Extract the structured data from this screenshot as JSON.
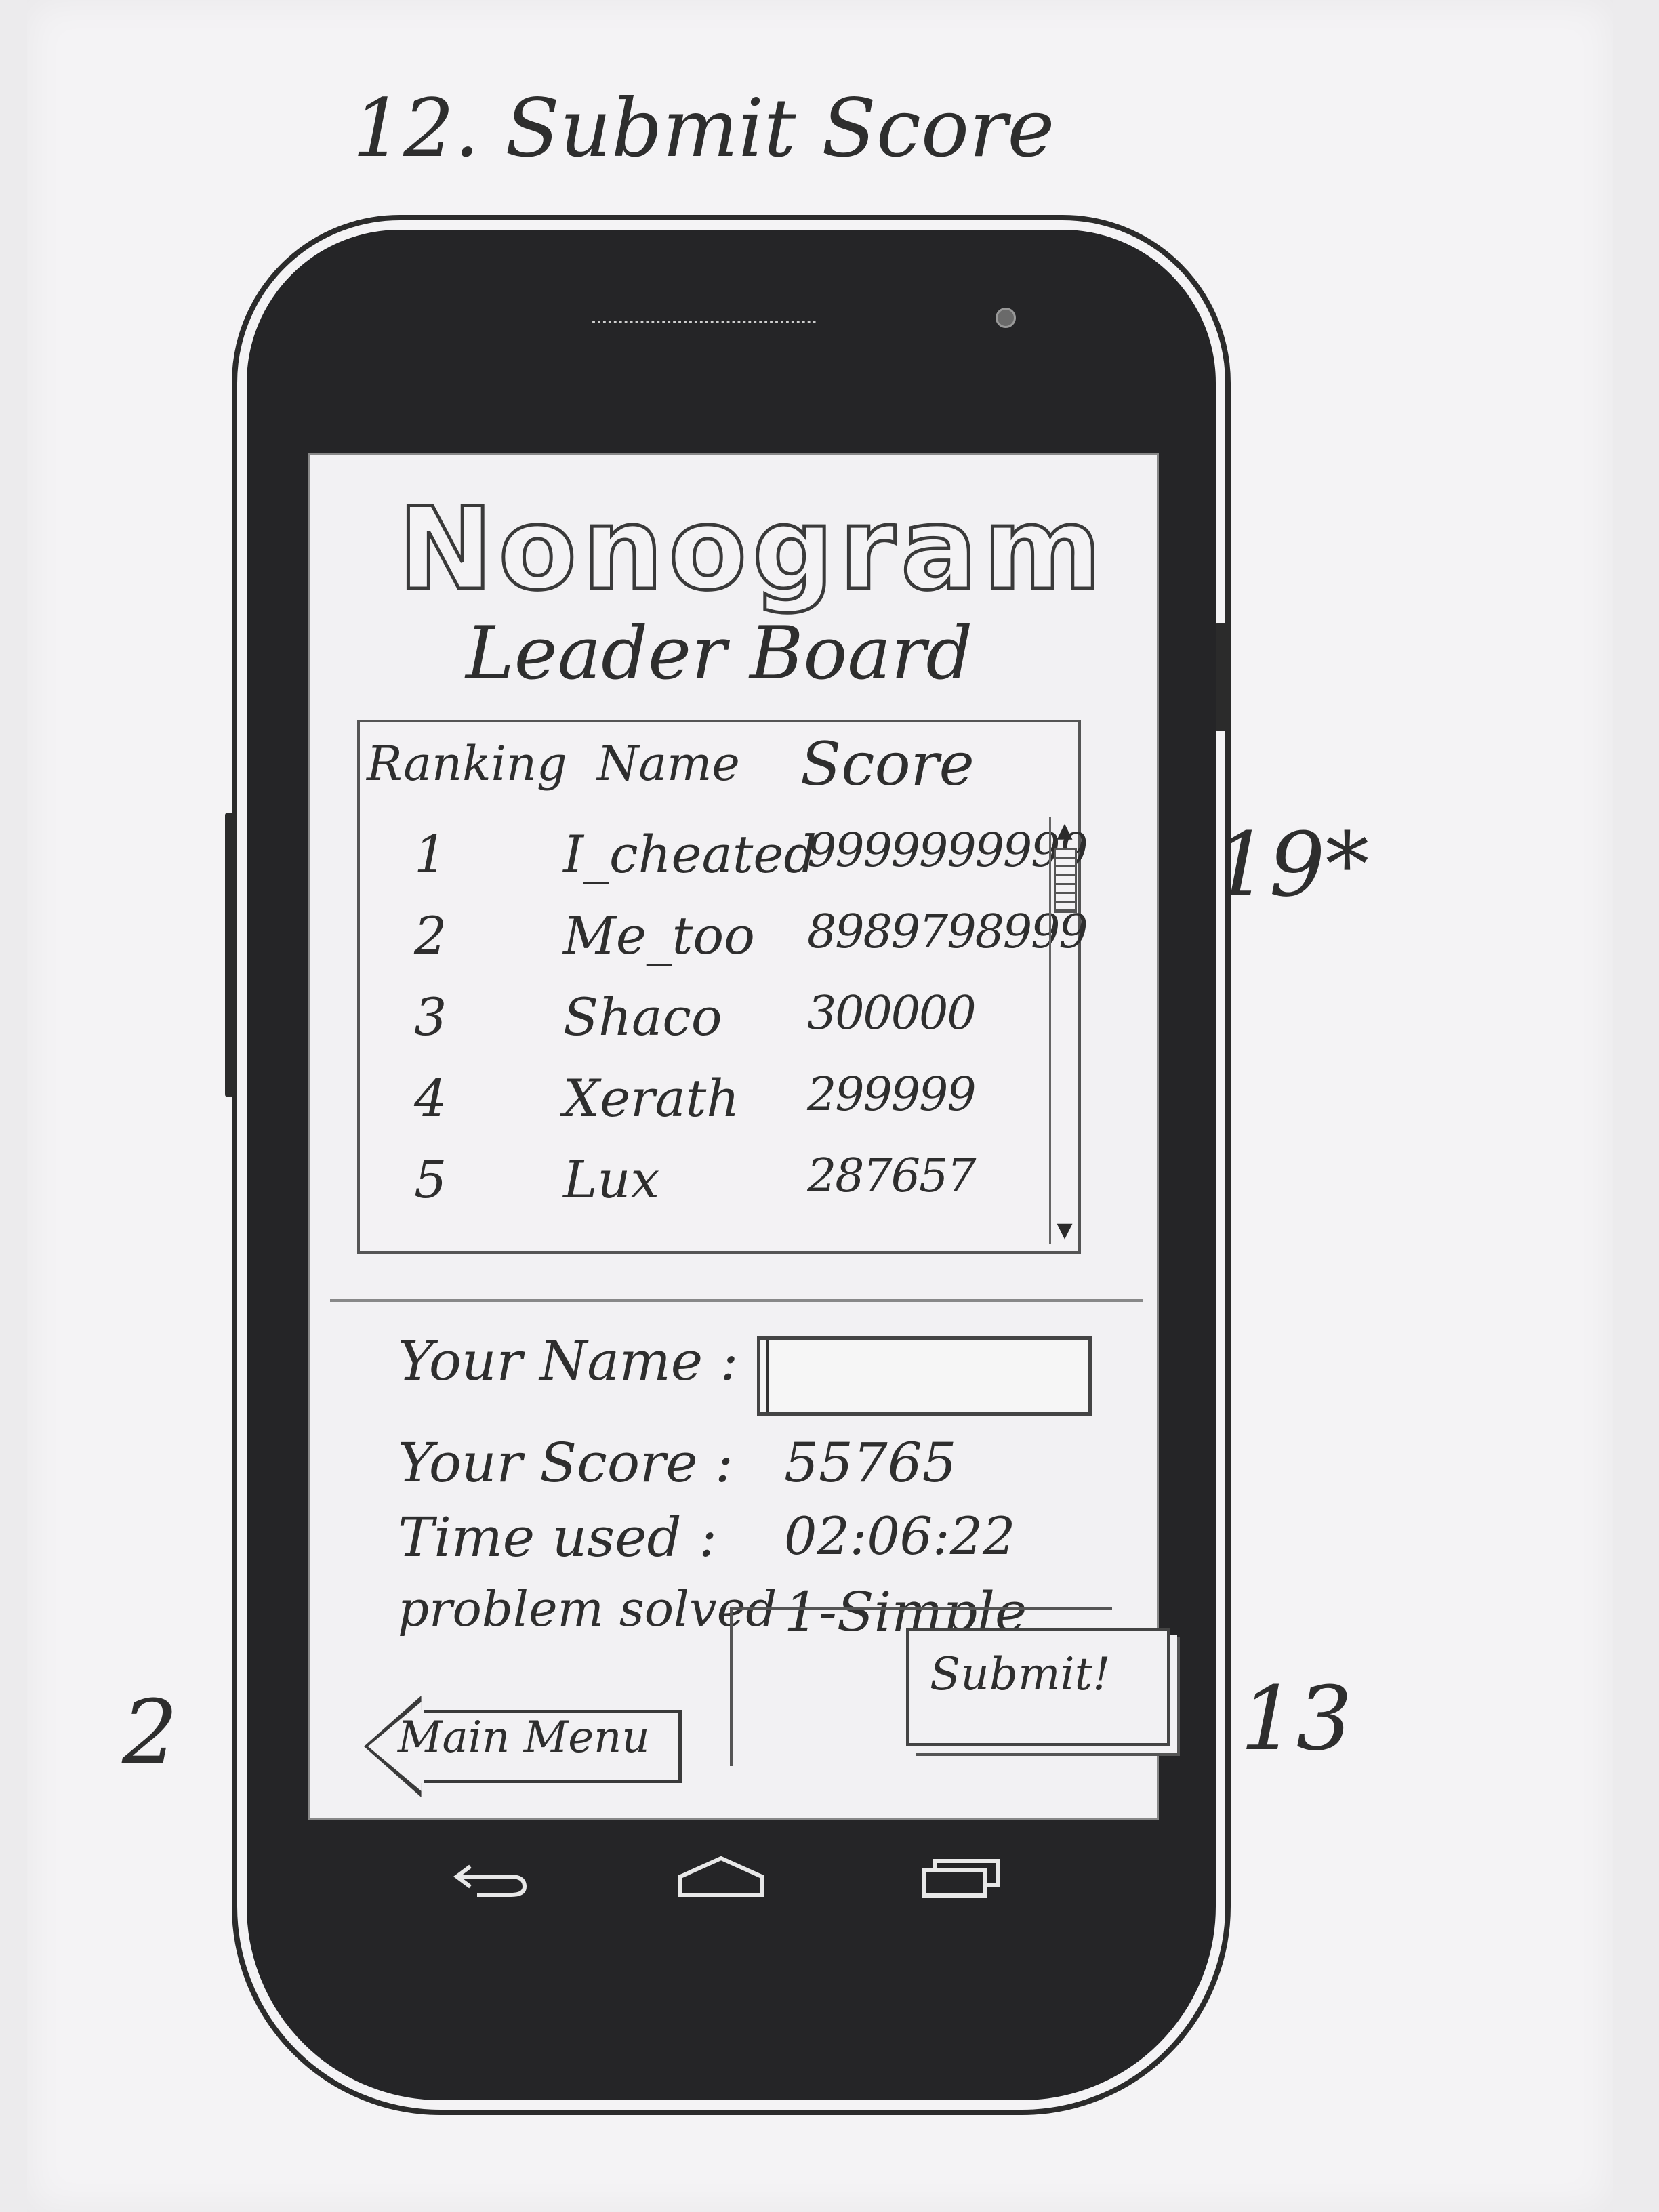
{
  "sheet": {
    "title": "12. Submit Score",
    "notes": {
      "right": "19*",
      "left_bottom": "2",
      "right_bottom": "13"
    }
  },
  "app": {
    "title": "Nonogram",
    "subtitle": "Leader Board"
  },
  "leaderboard": {
    "columns": [
      "Ranking",
      "Name",
      "Score"
    ],
    "rows": [
      {
        "rank": "1",
        "name": "I_cheated",
        "score": "9999999999"
      },
      {
        "rank": "2",
        "name": "Me_too",
        "score": "8989798999"
      },
      {
        "rank": "3",
        "name": "Shaco",
        "score": "300000"
      },
      {
        "rank": "4",
        "name": "Xerath",
        "score": "299999"
      },
      {
        "rank": "5",
        "name": "Lux",
        "score": "287657"
      }
    ]
  },
  "form": {
    "name_label": "Your Name :",
    "name_value": "",
    "score_label": "Your Score :",
    "score_value": "55765",
    "time_label": "Time used :",
    "time_value": "02:06:22",
    "problem_label": "problem solved :",
    "problem_value": "1-Simple"
  },
  "buttons": {
    "main_menu": "Main Menu",
    "submit": "Submit!"
  },
  "icons": {
    "nav": [
      "back-icon",
      "home-icon",
      "recent-apps-icon"
    ],
    "scroll": [
      "scroll-up-icon",
      "scroll-down-icon"
    ]
  }
}
